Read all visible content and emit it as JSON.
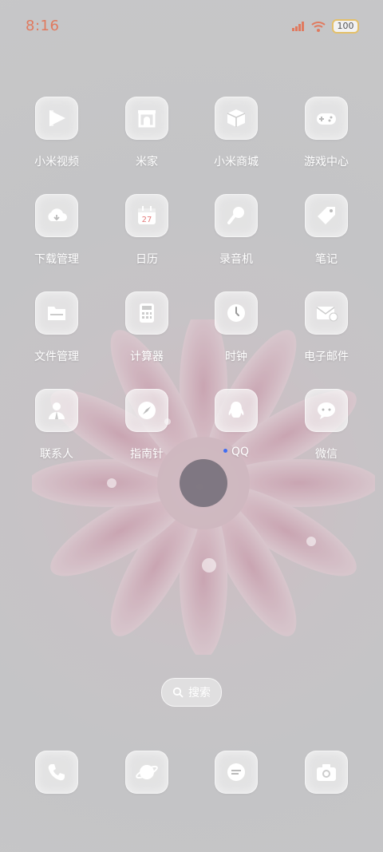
{
  "status": {
    "time": "8:16",
    "battery": "100"
  },
  "apps_row1": [
    {
      "label": "小米视频",
      "icon": "video-icon"
    },
    {
      "label": "米家",
      "icon": "mijia-home-icon"
    },
    {
      "label": "小米商城",
      "icon": "box-icon"
    },
    {
      "label": "游戏中心",
      "icon": "gamepad-icon"
    }
  ],
  "apps_row2": [
    {
      "label": "下载管理",
      "icon": "cloud-download-icon"
    },
    {
      "label": "日历",
      "icon": "calendar-icon",
      "date": "27"
    },
    {
      "label": "录音机",
      "icon": "microphone-icon"
    },
    {
      "label": "笔记",
      "icon": "tag-icon"
    }
  ],
  "apps_row3": [
    {
      "label": "文件管理",
      "icon": "folder-icon"
    },
    {
      "label": "计算器",
      "icon": "calculator-icon"
    },
    {
      "label": "时钟",
      "icon": "clock-icon"
    },
    {
      "label": "电子邮件",
      "icon": "mail-icon"
    }
  ],
  "apps_row4": [
    {
      "label": "联系人",
      "icon": "contacts-icon"
    },
    {
      "label": "指南针",
      "icon": "compass-icon"
    },
    {
      "label": "QQ",
      "icon": "qq-penguin-icon"
    },
    {
      "label": "微信",
      "icon": "chat-bubble-icon"
    }
  ],
  "search": {
    "label": "搜索"
  },
  "dock": [
    {
      "icon": "phone-icon"
    },
    {
      "icon": "browser-planet-icon"
    },
    {
      "icon": "messages-icon"
    },
    {
      "icon": "camera-icon"
    }
  ],
  "colors": {
    "time": "#e07a5f",
    "label": "#ffffff",
    "new_dot": "#3f6df2"
  }
}
